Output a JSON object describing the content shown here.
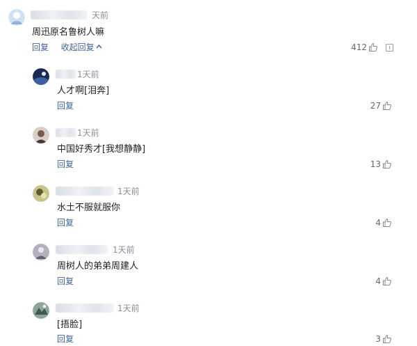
{
  "main": {
    "time": "天前",
    "text": "周迅原名鲁树人嘛",
    "reply_label": "回复",
    "collapse_label": "收起回复",
    "likes": "412"
  },
  "replies": [
    {
      "time": "1天前",
      "text": "人才啊[泪奔]",
      "reply_label": "回复",
      "likes": "27"
    },
    {
      "time": "1天前",
      "text": "中国好秀才[我想静静]",
      "reply_label": "回复",
      "likes": "13"
    },
    {
      "time": "1天前",
      "text": "水土不服就服你",
      "reply_label": "回复",
      "likes": "4"
    },
    {
      "time": "1天前",
      "text": "周树人的弟弟周建人",
      "reply_label": "回复",
      "likes": "4"
    },
    {
      "time": "1天前",
      "text": "[捂脸]",
      "reply_label": "回复",
      "likes": "3"
    }
  ],
  "colors": {
    "link": "#406599",
    "meta": "#8a8f99",
    "text": "#222222"
  },
  "icons": {
    "like": "thumb-up-icon",
    "report": "report-icon",
    "collapse": "chevron-up-icon"
  }
}
